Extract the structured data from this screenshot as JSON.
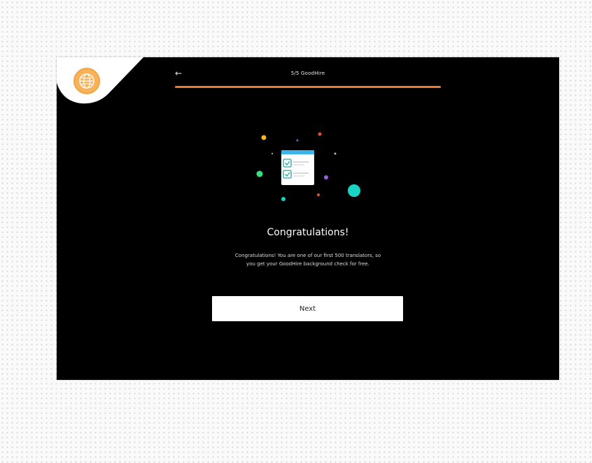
{
  "header": {
    "back_icon": "arrow-left-icon",
    "title": "5/5 GoodHire",
    "progress": 1.0
  },
  "badge": {
    "icon": "globe-icon"
  },
  "illustration": {
    "icon": "checklist-document-icon"
  },
  "content": {
    "heading": "Congratulations!",
    "message_line1": "Congratulations! You are one of our first 500 translators, so",
    "message_line2": "you get your GoodHire background check for free."
  },
  "actions": {
    "next_label": "Next"
  },
  "colors": {
    "accent": "#ea7a34",
    "background": "#000000",
    "button": "#ffffff",
    "teal": "#19d3c5",
    "green": "#35e07e",
    "yellow": "#f5b720",
    "doc_header": "#3bb5e8"
  }
}
